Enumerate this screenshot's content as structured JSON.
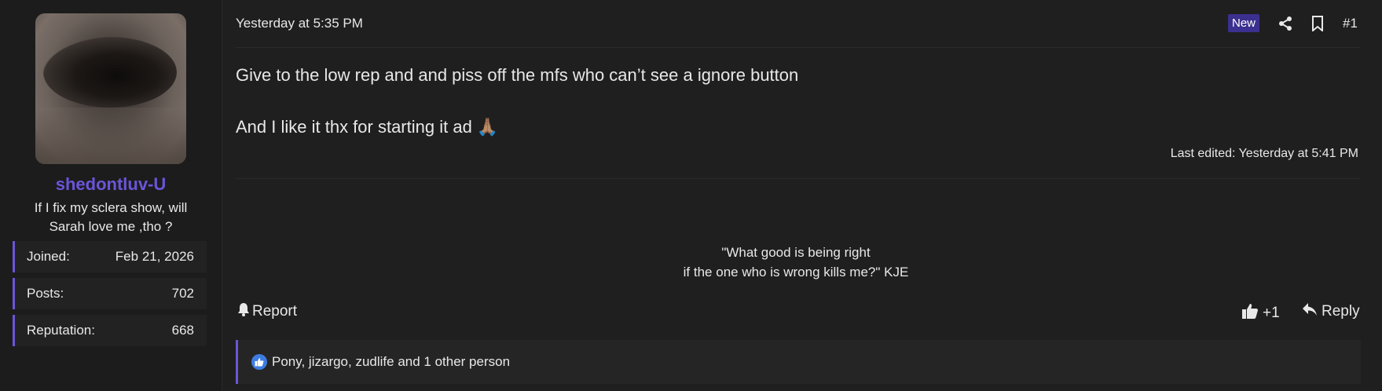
{
  "user": {
    "name": "shedontluv-U",
    "title": "If I fix my sclera show, will Sarah love me ,tho ?",
    "stats": [
      {
        "label": "Joined:",
        "value": "Feb 21, 2026"
      },
      {
        "label": "Posts:",
        "value": "702"
      },
      {
        "label": "Reputation:",
        "value": "668"
      }
    ]
  },
  "post": {
    "date": "Yesterday at 5:35 PM",
    "badge": "New",
    "number": "#1",
    "line1": "Give to the low rep and and piss off the mfs who can’t see a ignore button",
    "line2": "And I like it thx for starting it ad 🙏🏽",
    "edited": "Last edited: Yesterday at 5:41 PM",
    "signature_line1": "\"What good is being right",
    "signature_line2": "if the one who is wrong kills me?\" KJE"
  },
  "actions": {
    "report": "Report",
    "like_count": "+1",
    "reply": "Reply"
  },
  "reactions": {
    "text": "Pony, jizargo, zudlife and 1 other person"
  },
  "icons": {
    "share": "share-icon",
    "bookmark": "bookmark-icon",
    "bell": "bell-icon",
    "thumbs_up": "thumbs-up-icon",
    "reply": "reply-icon"
  },
  "colors": {
    "accent": "#6b55d9",
    "badge": "#3b2f8f",
    "reaction": "#3d7de0"
  }
}
